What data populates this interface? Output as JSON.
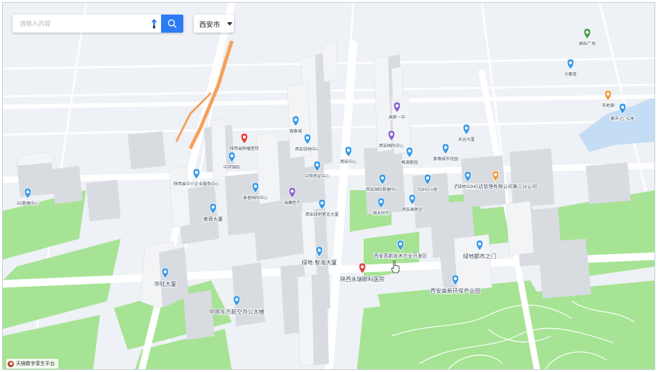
{
  "search": {
    "placeholder": "请输入内容"
  },
  "city": {
    "selected": "西安市"
  },
  "brand": {
    "text": "天镜数字孪生平台"
  },
  "colors": {
    "accent": "#2d7bf4",
    "ground": "#eef1f5",
    "park": "#9fe08d",
    "road": "#ffffff",
    "building": "#f3f4f6",
    "poi_blue": "#3a9be8",
    "poi_red": "#e0413a",
    "poi_purple": "#8a63d2",
    "poi_orange": "#f09a3e",
    "poi_green": "#43a047",
    "water": "#c4dcf4"
  },
  "icons": {
    "route": "navigate-arrow-icon",
    "search": "magnifier-icon",
    "caret": "caret-down-icon",
    "brand": "brand-logo-icon",
    "cursor": "hand-cursor-icon"
  },
  "pois": [
    {
      "label": "华陆大厦",
      "color": "blue"
    },
    {
      "label": "中国东方航空办公大楼",
      "color": "blue"
    },
    {
      "label": "绿地·智海大厦",
      "color": "blue"
    },
    {
      "label": "陕西永瑞眼科医院",
      "color": "red"
    },
    {
      "label": "西安高新技术产业开发区",
      "color": "blue"
    },
    {
      "label": "绿地都市之门",
      "color": "blue"
    },
    {
      "label": "西安高新环保产业园",
      "color": "blue"
    },
    {
      "label": "西安锦尚酒店管理有限公司第二分公司",
      "color": "orange"
    },
    {
      "label": "紫薇大厦",
      "color": "blue"
    },
    {
      "label": "陕西省中小企业服务中心",
      "color": "blue"
    },
    {
      "label": "泰普国际中心",
      "color": "blue"
    },
    {
      "label": "瑞康医疗",
      "color": "purple"
    },
    {
      "label": "西安绿地笔克大厦",
      "color": "blue"
    },
    {
      "label": "中铁西安中心",
      "color": "blue"
    },
    {
      "label": "西安绿地中心",
      "color": "blue"
    },
    {
      "label": "SOHO A座",
      "color": "blue"
    },
    {
      "label": "绿地SOHO",
      "color": "blue"
    },
    {
      "label": "陕西省肿瘤医院",
      "color": "red"
    },
    {
      "label": "3G数据中心",
      "color": "blue"
    },
    {
      "label": "中环国际",
      "color": "blue"
    },
    {
      "label": "西安高新区",
      "color": "blue"
    },
    {
      "label": "格调家园",
      "color": "blue"
    },
    {
      "label": "西安国际中心",
      "color": "purple"
    },
    {
      "label": "紫薇城市花园",
      "color": "blue"
    },
    {
      "label": "西安国际数据中心",
      "color": "blue"
    },
    {
      "label": "天谷大厦",
      "color": "blue"
    },
    {
      "label": "高新一中",
      "color": "purple"
    },
    {
      "label": "锦业时代",
      "color": "blue"
    },
    {
      "label": "银泰城",
      "color": "blue"
    },
    {
      "label": "西安中心",
      "color": "blue"
    },
    {
      "label": "天地源",
      "color": "orange"
    },
    {
      "label": "大都荟",
      "color": "blue"
    },
    {
      "label": "高科广场",
      "color": "green"
    },
    {
      "label": "都市之门C座",
      "color": "blue"
    }
  ]
}
